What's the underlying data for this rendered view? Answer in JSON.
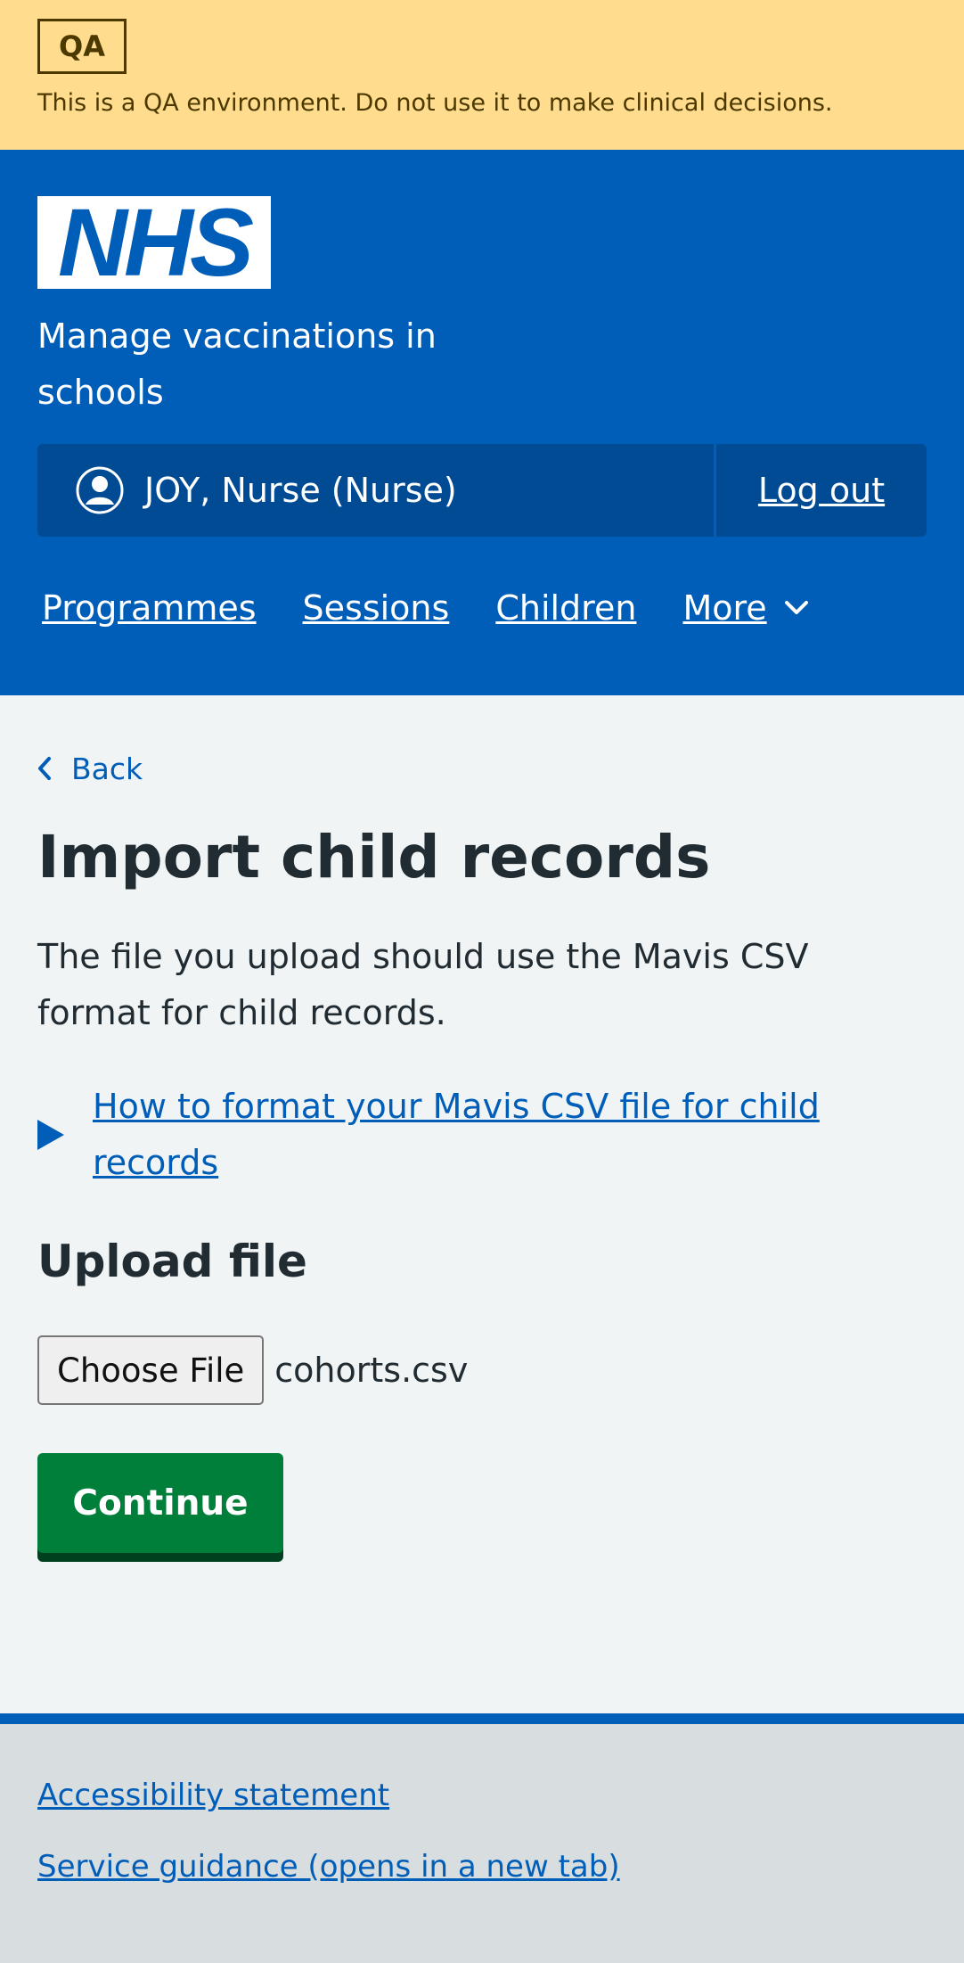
{
  "env_banner": {
    "tag": "QA",
    "message": "This is a QA environment. Do not use it to make clinical decisions."
  },
  "header": {
    "logo_text": "NHS",
    "service_name": "Manage vaccinations in schools",
    "user_label": "JOY, Nurse (Nurse)",
    "logout_label": "Log out",
    "nav": [
      "Programmes",
      "Sessions",
      "Children",
      "More"
    ]
  },
  "main": {
    "back_label": "Back",
    "title": "Import child records",
    "lede": "The file you upload should use the Mavis CSV format for child records.",
    "details_summary": "How to format your Mavis CSV file for child records",
    "upload_heading": "Upload file",
    "choose_file_label": "Choose File",
    "selected_file": "cohorts.csv",
    "continue_label": "Continue"
  },
  "footer": {
    "links": [
      "Accessibility statement",
      "Service guidance (opens in a new tab)"
    ]
  },
  "colors": {
    "nhs_blue": "#005eb8",
    "banner_yellow": "#ffdc8e",
    "button_green": "#007f3b",
    "background": "#f0f4f5",
    "footer_grey": "#d8dde0"
  },
  "icons": [
    "user-icon",
    "chevron-down-icon",
    "chevron-left-icon",
    "triangle-right-icon"
  ]
}
